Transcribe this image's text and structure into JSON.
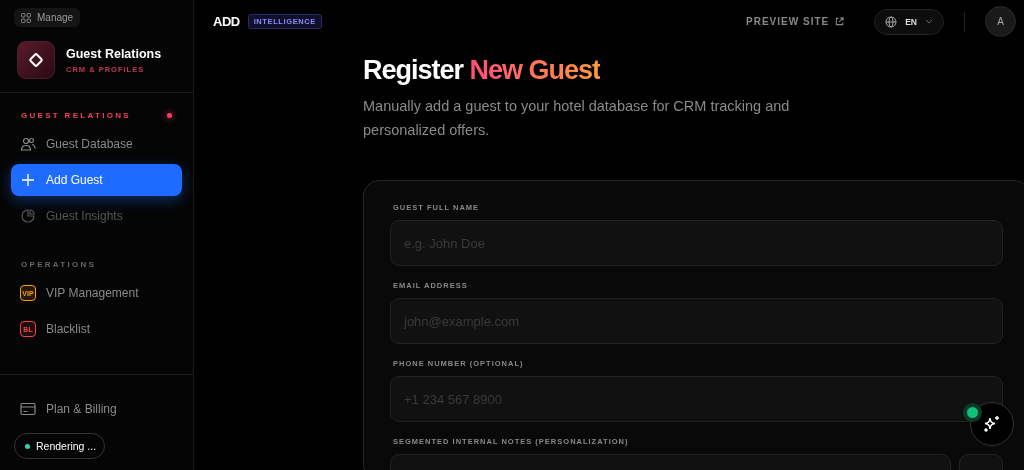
{
  "sidebar": {
    "manage_button": "Manage",
    "brand": {
      "title": "Guest Relations",
      "subtitle": "CRM & PROFILES"
    },
    "sections": [
      {
        "title": "GUEST RELATIONS",
        "alert": true,
        "items": [
          {
            "label": "Guest Database",
            "kind": "users",
            "selected": false,
            "disabled": false
          },
          {
            "label": "Add Guest",
            "kind": "plus",
            "selected": true,
            "disabled": false
          },
          {
            "label": "Guest Insights",
            "kind": "chart",
            "selected": false,
            "disabled": true
          }
        ]
      },
      {
        "title": "OPERATIONS",
        "alert": false,
        "items": [
          {
            "label": "VIP Management",
            "kind": "tag",
            "tag": "VIP",
            "color": "#f59e0b",
            "selected": false,
            "disabled": false
          },
          {
            "label": "Blacklist",
            "kind": "tag",
            "tag": "BL",
            "color": "#ef4444",
            "selected": false,
            "disabled": false
          }
        ]
      }
    ],
    "billing": "Plan & Billing",
    "status": "Rendering ..."
  },
  "topbar": {
    "logo": "ADD",
    "badge": "INTELLIGENCE",
    "preview": "PREVIEW SITE",
    "language": "EN",
    "avatar": "A"
  },
  "page": {
    "title_plain": "Register",
    "title_accent": "New Guest",
    "subtitle": "Manually add a guest to your hotel database for CRM tracking and personalized offers."
  },
  "form": {
    "fields": [
      {
        "label": "GUEST FULL NAME",
        "placeholder": "e.g. John Doe"
      },
      {
        "label": "EMAIL ADDRESS",
        "placeholder": "john@example.com"
      },
      {
        "label": "PHONE NUMBER (OPTIONAL)",
        "placeholder": "+1 234 567 8900"
      },
      {
        "label": "SEGMENTED INTERNAL NOTES (PERSONALIZATION)",
        "kind": "segmented"
      }
    ]
  },
  "assistant": {
    "online": true
  }
}
